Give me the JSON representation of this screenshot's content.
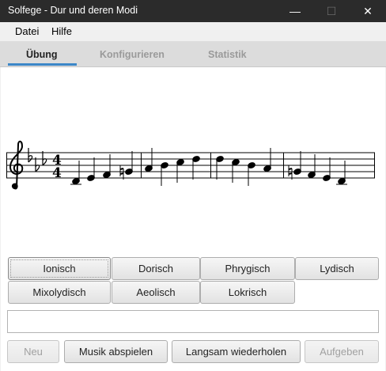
{
  "window": {
    "title": "Solfege - Dur und deren Modi",
    "minimize_glyph": "—",
    "maximize_glyph": "☐",
    "close_glyph": "✕"
  },
  "menu": [
    "Datei",
    "Hilfe"
  ],
  "tabs": [
    {
      "label": "Übung",
      "active": true
    },
    {
      "label": "Konfigurieren",
      "active": false
    },
    {
      "label": "Statistik",
      "active": false
    }
  ],
  "notation": {
    "clef": "treble",
    "key_signature": "3 flats",
    "time_signature": "4/4"
  },
  "mode_buttons": {
    "row1": [
      "Ionisch",
      "Dorisch",
      "Phrygisch",
      "Lydisch"
    ],
    "row2": [
      "Mixolydisch",
      "Aeolisch",
      "Lokrisch"
    ]
  },
  "answer": {
    "value": ""
  },
  "actions": {
    "new": "Neu",
    "play": "Musik abspielen",
    "repeat_slow": "Langsam wiederholen",
    "give_up": "Aufgeben"
  },
  "colors": {
    "titlebar": "#2b2b2b",
    "tab_accent": "#3c87c8"
  }
}
